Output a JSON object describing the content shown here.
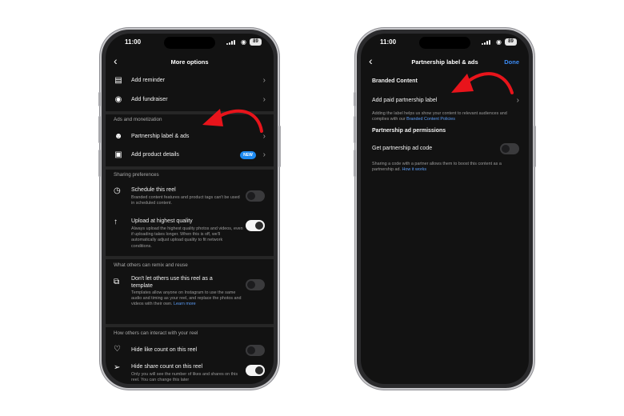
{
  "left_phone": {
    "status": {
      "time": "11:00",
      "battery": "89"
    },
    "nav": {
      "title": "More options"
    },
    "rows_top": [
      {
        "label": "Add reminder"
      },
      {
        "label": "Add fundraiser"
      }
    ],
    "sections": {
      "ads": "Ads and monetization",
      "sharing": "Sharing preferences",
      "remix": "What others can remix and reuse",
      "interact": "How others can interact with your reel"
    },
    "ads_rows": [
      {
        "label": "Partnership label & ads"
      },
      {
        "label": "Add product details",
        "badge": "NEW"
      }
    ],
    "schedule": {
      "title": "Schedule this reel",
      "desc": "Branded content features and product tags can't be used in scheduled content.",
      "toggle_on": false
    },
    "upload": {
      "title": "Upload at highest quality",
      "desc": "Always upload the highest quality photos and videos, even if uploading takes longer. When this is off, we'll automatically adjust upload quality to fit network conditions.",
      "toggle_on": true
    },
    "template": {
      "title": "Don't let others use this reel as a template",
      "desc": "Templates allow anyone on Instagram to use the same audio and timing as your reel, and replace the photos and videos with their own.",
      "link": "Learn more",
      "toggle_on": false
    },
    "hide_like": {
      "title": "Hide like count on this reel",
      "toggle_on": false
    },
    "hide_share": {
      "title": "Hide share count on this reel",
      "desc": "Only you will see the number of likes and shares on this reel. You can change this later",
      "toggle_on": true
    }
  },
  "right_phone": {
    "status": {
      "time": "11:00",
      "battery": "89"
    },
    "nav": {
      "title": "Partnership label & ads",
      "done": "Done"
    },
    "branded_heading": "Branded Content",
    "paid_label": "Add paid partnership label",
    "paid_desc": "Adding the label helps us show your content to relevant audiences and complies with our",
    "paid_desc_link": "Branded Content Policies",
    "permissions_heading": "Partnership ad permissions",
    "ad_code_label": "Get partnership ad code",
    "ad_code_toggle_on": false,
    "code_desc": "Sharing a code with a partner allows them to boost this content as a partnership ad.",
    "code_desc_link": "How it works"
  },
  "colors": {
    "accent_blue": "#3b8bf5",
    "annotation_arrow": "#e8141b"
  }
}
